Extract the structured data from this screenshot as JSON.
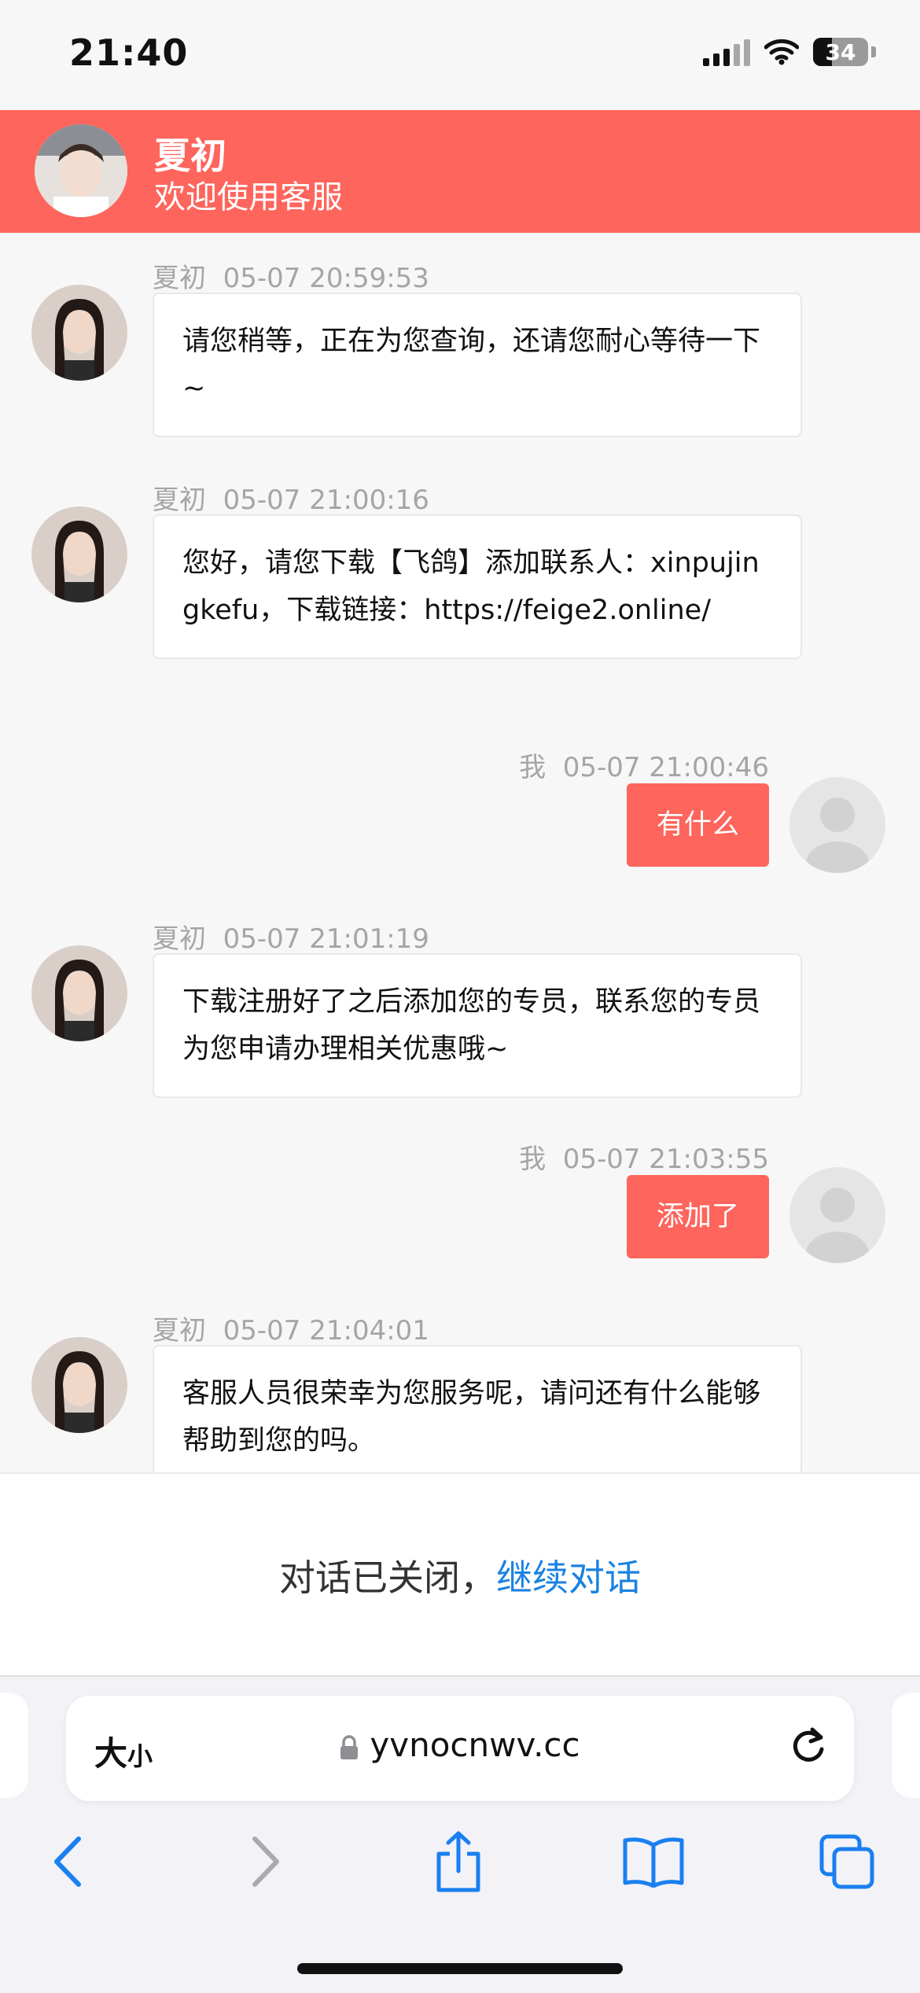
{
  "status_bar": {
    "time": "21:40",
    "battery": "34",
    "icons": [
      "cellular-signal-icon",
      "wifi-icon",
      "battery-icon"
    ]
  },
  "header": {
    "name": "夏初",
    "subtitle": "欢迎使用客服"
  },
  "messages": [
    {
      "side": "left",
      "sender": "夏初",
      "time": "05-07 20:59:53",
      "text": "请您稍等，正在为您查询，还请您耐心等待一下~"
    },
    {
      "side": "left",
      "sender": "夏初",
      "time": "05-07 21:00:16",
      "text": "您好，请您下载【飞鸽】添加联系人：xinpujingkefu，下载链接：https://feige2.online/"
    },
    {
      "side": "right",
      "sender": "我",
      "time": "05-07 21:00:46",
      "text": "有什么"
    },
    {
      "side": "left",
      "sender": "夏初",
      "time": "05-07 21:01:19",
      "text": "下载注册好了之后添加您的专员，联系您的专员为您申请办理相关优惠哦~"
    },
    {
      "side": "right",
      "sender": "我",
      "time": "05-07 21:03:55",
      "text": "添加了"
    },
    {
      "side": "left",
      "sender": "夏初",
      "time": "05-07 21:04:01",
      "text": "客服人员很荣幸为您服务呢，请问还有什么能够帮助到您的吗。"
    }
  ],
  "closed_bar": {
    "text": "对话已关闭，",
    "link": "继续对话"
  },
  "browser": {
    "text_size_big": "大",
    "text_size_small": "小",
    "url": "yvnocnwv.cc",
    "toolbar_icons": [
      "back-icon",
      "forward-icon",
      "share-icon",
      "bookmarks-icon",
      "tabs-icon"
    ]
  },
  "colors": {
    "accent": "#fe655c",
    "link": "#1a82e2",
    "bubble_left": "#ffffff"
  }
}
